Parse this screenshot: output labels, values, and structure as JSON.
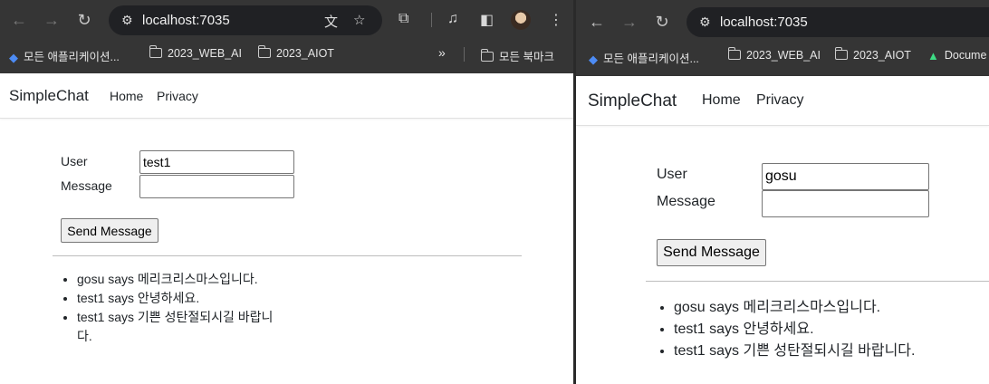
{
  "browser": {
    "url": "localhost:7035",
    "bookmarks": {
      "apps": "모든 애플리케이션...",
      "web_ai": "2023_WEB_AI",
      "aiot": "2023_AIOT",
      "all_bookmarks": "모든 북마크",
      "documents": "Docume",
      "more": "»"
    }
  },
  "app": {
    "brand": "SimpleChat",
    "nav": {
      "home": "Home",
      "privacy": "Privacy"
    },
    "form": {
      "user_label": "User",
      "message_label": "Message",
      "send_label": "Send Message"
    }
  },
  "left": {
    "user_value": "test1",
    "message_value": "",
    "messages": [
      "gosu says 메리크리스마스입니다.",
      "test1 says 안녕하세요.",
      "test1 says 기쁜 성탄절되시길 바랍니다."
    ]
  },
  "right": {
    "user_value": "gosu",
    "message_value": "",
    "messages": [
      "gosu says 메리크리스마스입니다.",
      "test1 says 안녕하세요.",
      "test1 says 기쁜 성탄절되시길 바랍니다."
    ]
  }
}
